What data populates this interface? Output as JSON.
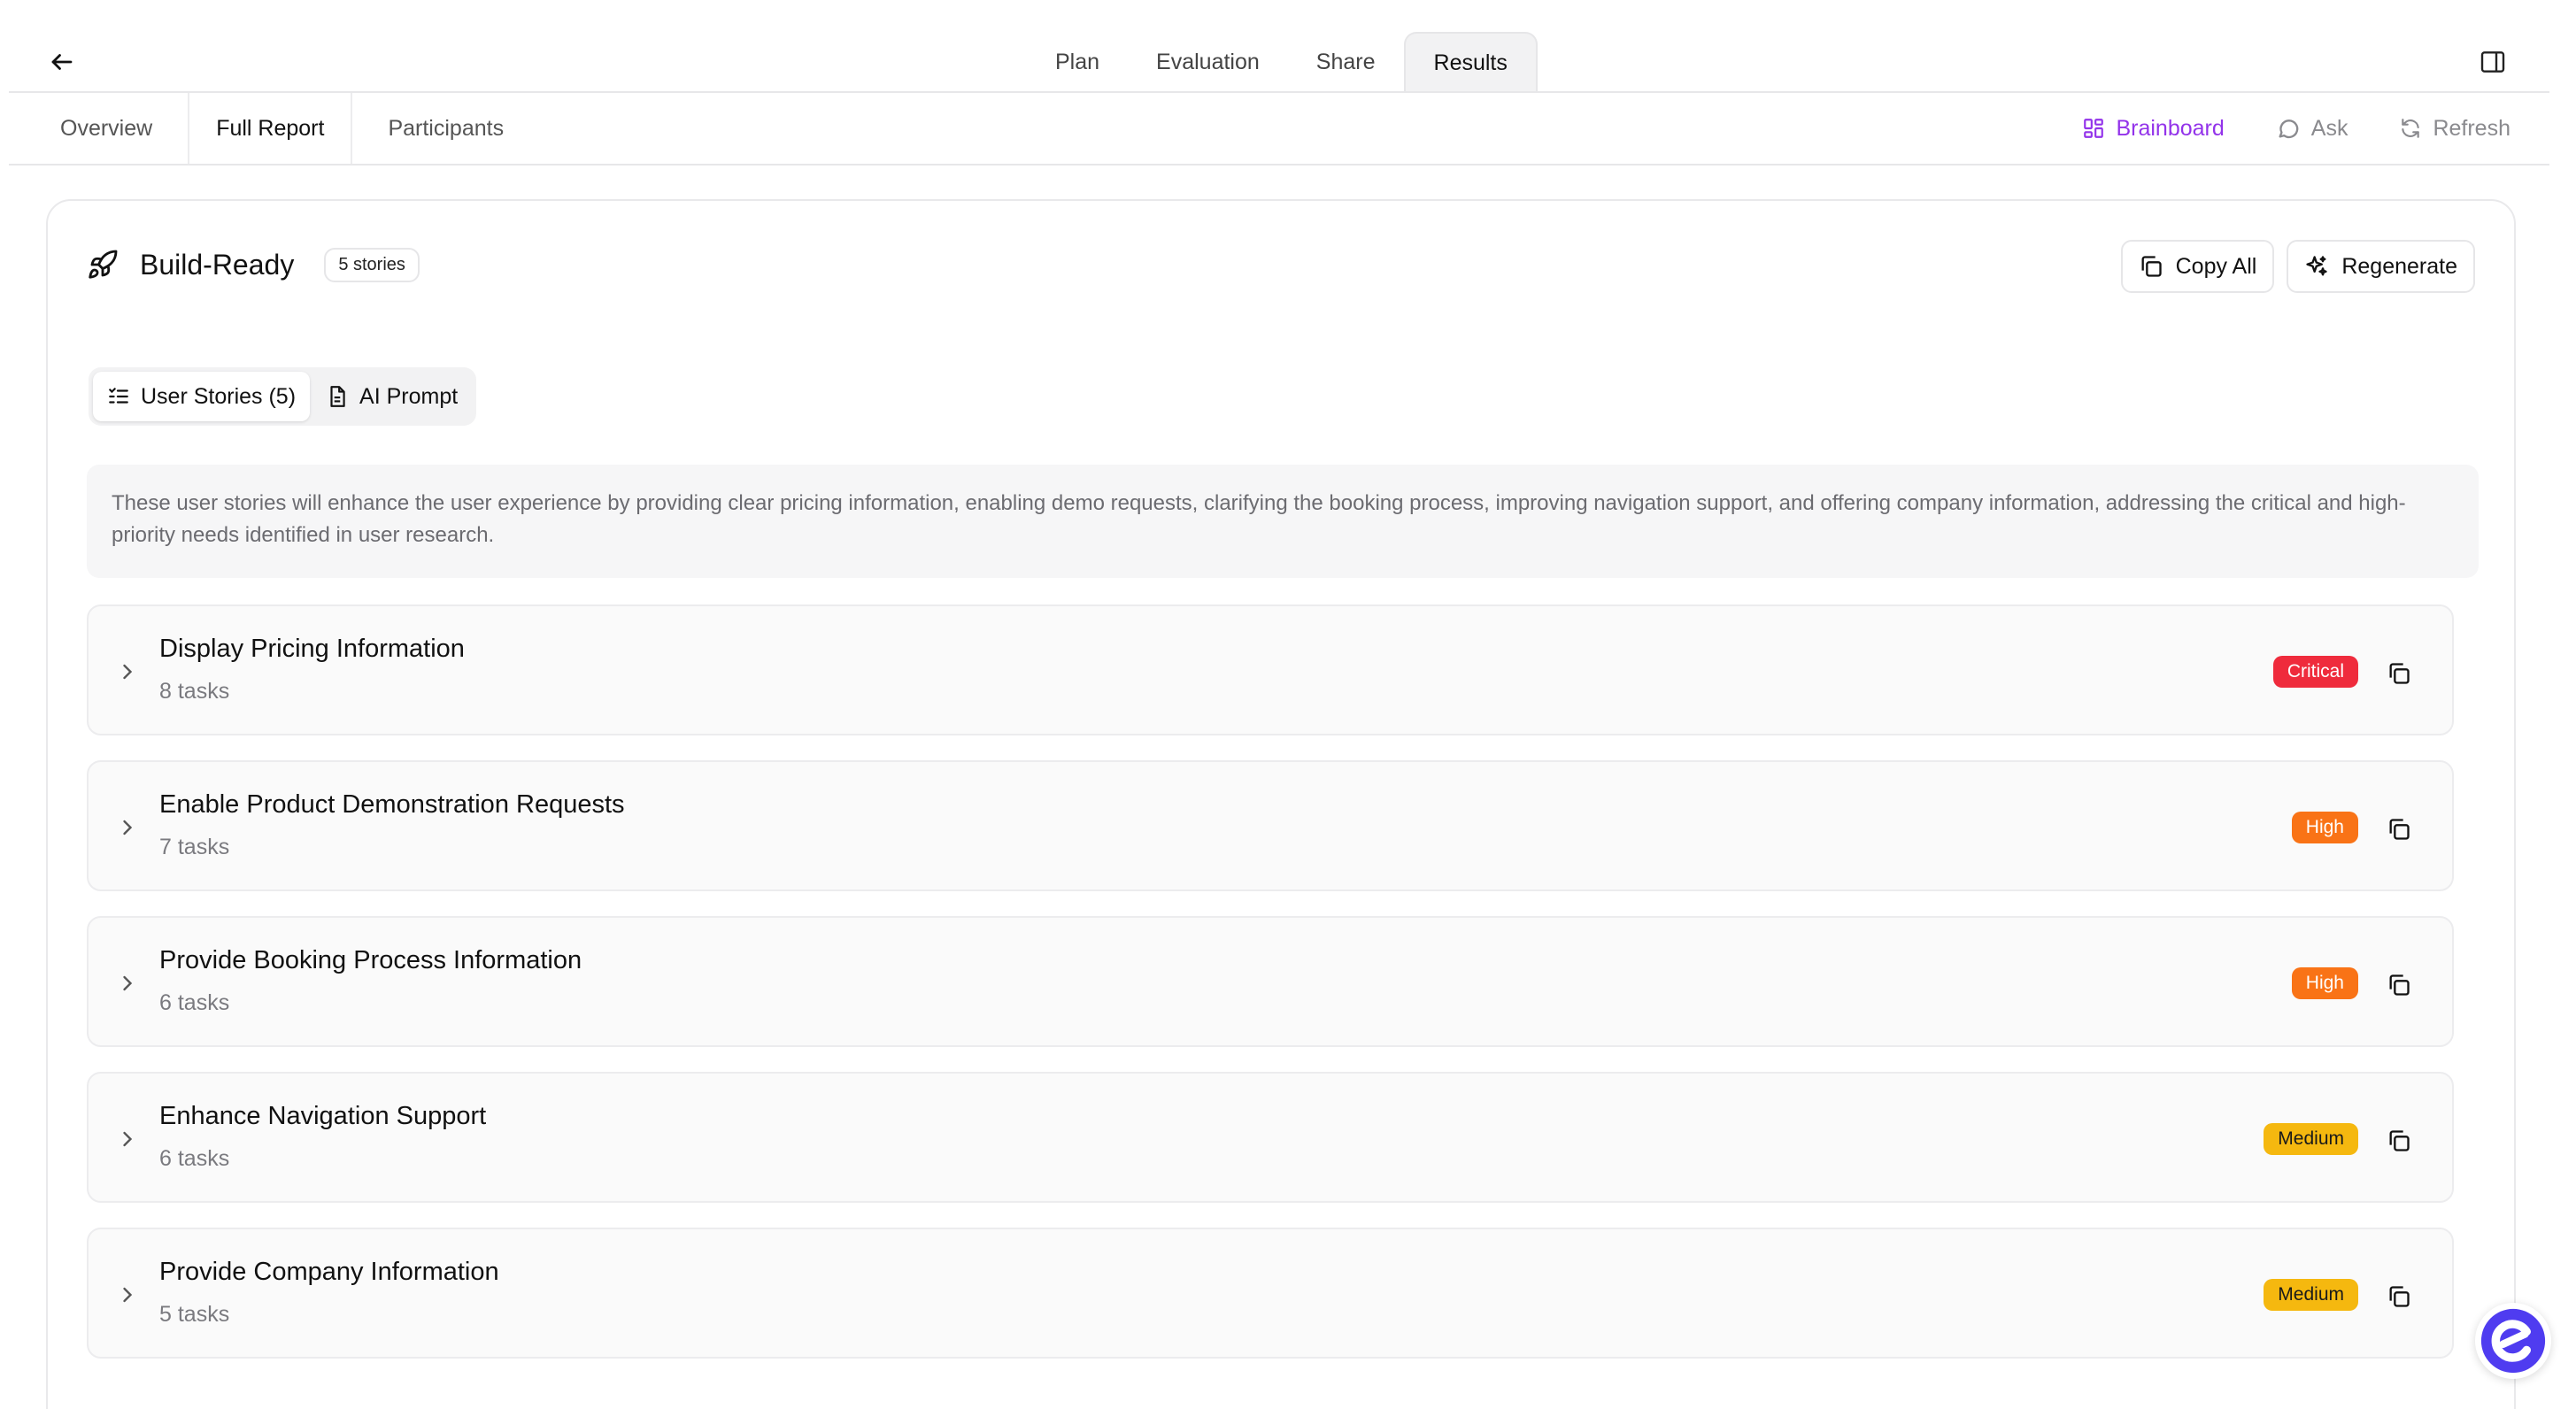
{
  "header": {
    "tabs": [
      {
        "label": "Plan"
      },
      {
        "label": "Evaluation"
      },
      {
        "label": "Share"
      },
      {
        "label": "Results"
      }
    ],
    "active_tab": "Results"
  },
  "subnav": {
    "tabs": [
      {
        "label": "Overview"
      },
      {
        "label": "Full Report"
      },
      {
        "label": "Participants"
      }
    ],
    "active_tab": "Full Report",
    "actions": {
      "brainboard": "Brainboard",
      "ask": "Ask",
      "refresh": "Refresh"
    }
  },
  "card": {
    "title": "Build-Ready",
    "count_badge": "5 stories",
    "copy_all": "Copy All",
    "regenerate": "Regenerate",
    "segments": {
      "user_stories": "User Stories (5)",
      "ai_prompt": "AI Prompt"
    },
    "summary": "These user stories will enhance the user experience by providing clear pricing information, enabling demo requests, clarifying the booking process, improving navigation support, and offering company information, addressing the critical and high-priority needs identified in user research."
  },
  "stories": [
    {
      "title": "Display Pricing Information",
      "tasks": "8 tasks",
      "priority": "Critical"
    },
    {
      "title": "Enable Product Demonstration Requests",
      "tasks": "7 tasks",
      "priority": "High"
    },
    {
      "title": "Provide Booking Process Information",
      "tasks": "6 tasks",
      "priority": "High"
    },
    {
      "title": "Enhance Navigation Support",
      "tasks": "6 tasks",
      "priority": "Medium"
    },
    {
      "title": "Provide Company Information",
      "tasks": "5 tasks",
      "priority": "Medium"
    }
  ],
  "colors": {
    "critical_bg": "#ef2b3c",
    "critical_text": "#ffffff",
    "high_bg": "#f97316",
    "high_text": "#ffffff",
    "medium_bg": "#f5b80f",
    "medium_text": "#1a1a1a",
    "brainboard": "#9333ea",
    "logo": "#4f3cf0"
  },
  "icons": {
    "back": "arrow-left-icon",
    "panel": "sidebar-panel-icon",
    "brainboard": "grid-icon",
    "ask": "chat-bubble-icon",
    "refresh": "refresh-icon",
    "rocket": "rocket-icon",
    "copy": "copy-icon",
    "sparkles": "sparkles-icon",
    "list": "list-check-icon",
    "document": "document-icon",
    "chevron": "chevron-right-icon",
    "logo": "brand-logo-icon"
  }
}
